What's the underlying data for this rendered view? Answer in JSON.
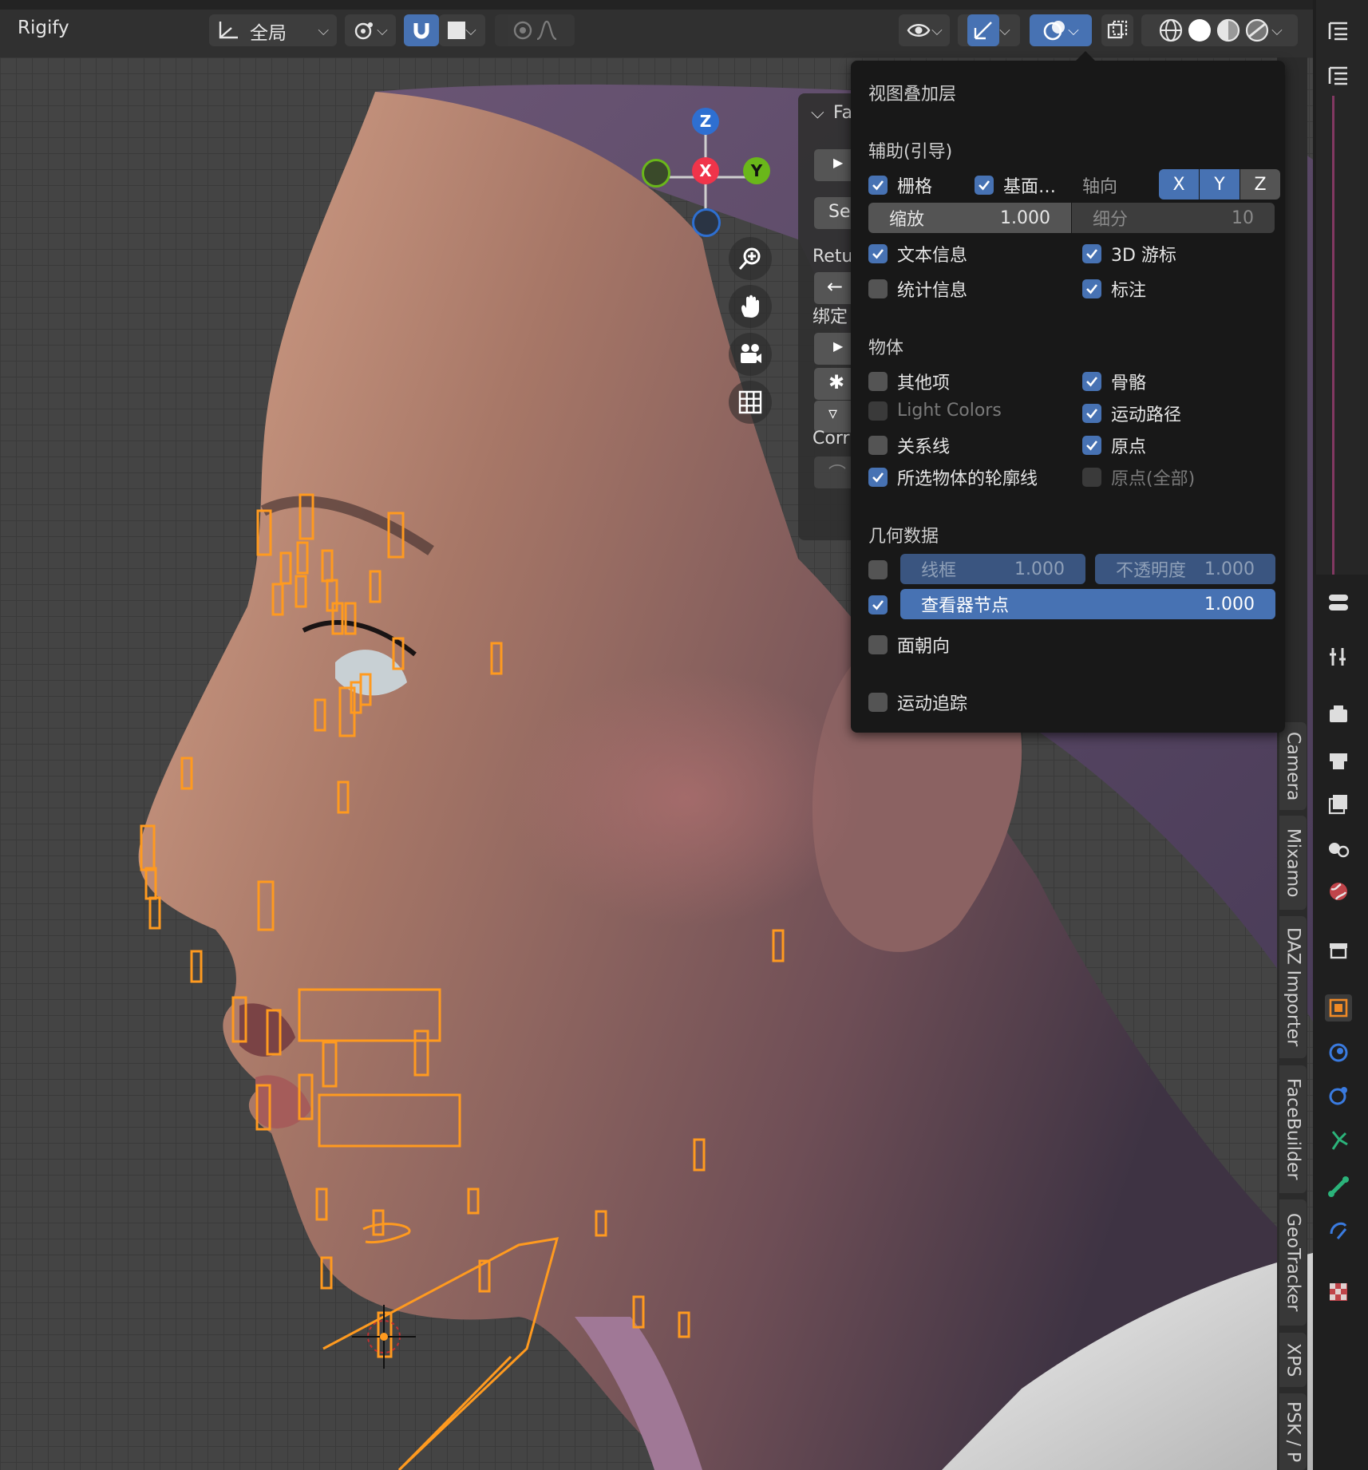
{
  "header": {
    "workspace": "Rigify",
    "orientation": "全局"
  },
  "gizmo": {
    "x": "X",
    "y": "Y",
    "z": "Z"
  },
  "npanel": {
    "header": "Fa",
    "btn_se": "Se",
    "retu": "Retu",
    "bind": "绑定",
    "corr": "Corr"
  },
  "vtabs": [
    "Camera",
    "Mixamo",
    "DAZ Importer",
    "FaceBuilder",
    "GeoTracker",
    "XPS",
    "PSK / P"
  ],
  "popup": {
    "title": "视图叠加层",
    "guides": {
      "title": "辅助(引导)",
      "grid": "栅格",
      "floor": "基面…",
      "axis_label": "轴向",
      "axes": [
        "X",
        "Y",
        "Z"
      ],
      "scale_label": "缩放",
      "scale_value": "1.000",
      "subdiv_label": "细分",
      "subdiv_value": "10",
      "text_info": "文本信息",
      "cursor3d": "3D 游标",
      "stats": "统计信息",
      "annotations": "标注"
    },
    "objects": {
      "title": "物体",
      "extras": "其他项",
      "light_colors": "Light Colors",
      "relationship": "关系线",
      "outline": "所选物体的轮廓线",
      "bones": "骨骼",
      "motion_paths": "运动路径",
      "origins": "原点",
      "origins_all": "原点(全部)"
    },
    "geometry": {
      "title": "几何数据",
      "wireframe": "线框",
      "wireframe_value": "1.000",
      "opacity": "不透明度",
      "opacity_value": "1.000",
      "viewer_node": "查看器节点",
      "viewer_value": "1.000",
      "face_orientation": "面朝向",
      "motion_tracking": "运动追踪"
    }
  },
  "colors": {
    "accent": "#4772b3",
    "bone_orange": "#ff9a1f",
    "annotation_yellow": "#c6a828"
  }
}
